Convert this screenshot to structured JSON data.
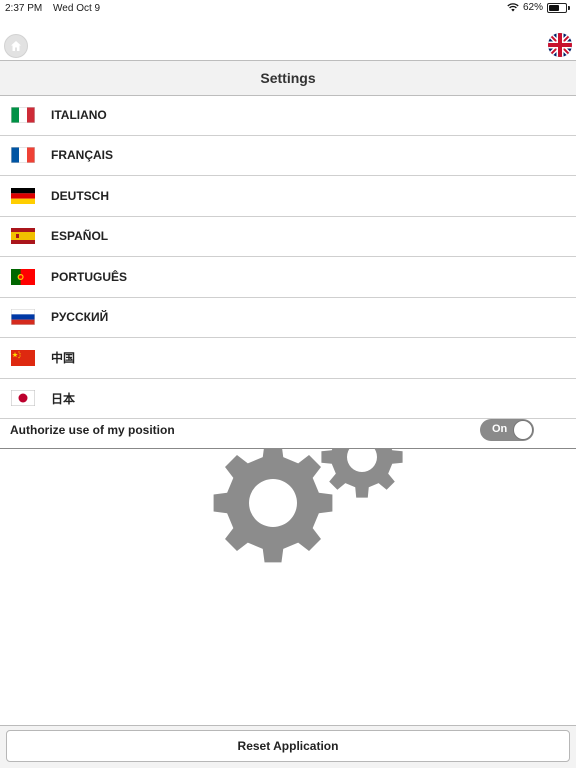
{
  "status_bar": {
    "time": "2:37 PM",
    "date": "Wed Oct 9",
    "battery_percent": "62%",
    "battery_level": 0.62
  },
  "header": {
    "title": "Settings"
  },
  "icons": {
    "home": "home-icon",
    "language": "uk-flag-icon",
    "wifi": "wifi-icon"
  },
  "languages": [
    {
      "label": "ITALIANO",
      "flag": "italy-flag-icon"
    },
    {
      "label": "FRANÇAIS",
      "flag": "france-flag-icon"
    },
    {
      "label": "DEUTSCH",
      "flag": "germany-flag-icon"
    },
    {
      "label": "ESPAÑOL",
      "flag": "spain-flag-icon"
    },
    {
      "label": "PORTUGUÊS",
      "flag": "portugal-flag-icon"
    },
    {
      "label": "РУССКИЙ",
      "flag": "russia-flag-icon"
    },
    {
      "label": "中国",
      "flag": "china-flag-icon"
    },
    {
      "label": "日本",
      "flag": "japan-flag-icon"
    }
  ],
  "position_setting": {
    "label": "Authorize use of my position",
    "toggle_text": "On",
    "enabled": true
  },
  "reset_button": {
    "label": "Reset Application"
  },
  "colors": {
    "toggle_on": "#8a8a8a",
    "gear": "#8c8c8c"
  }
}
